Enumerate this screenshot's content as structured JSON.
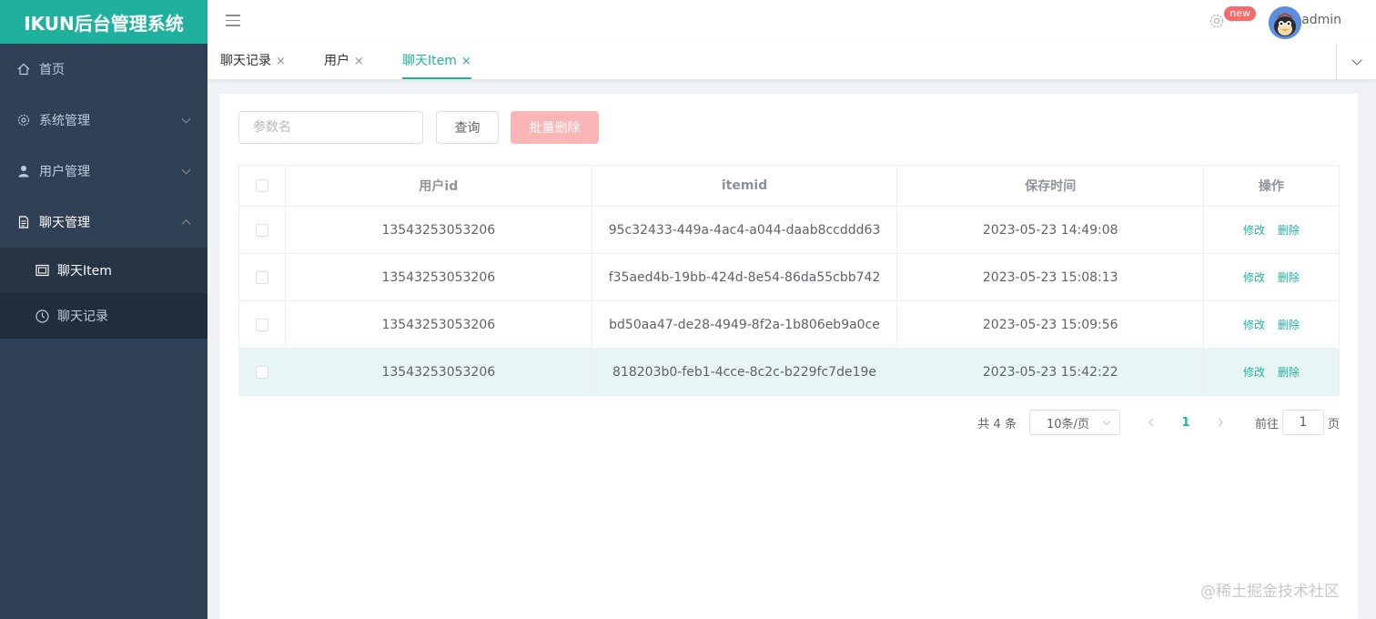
{
  "app": {
    "title": "IKUN后台管理系统"
  },
  "sidebar": {
    "items": [
      {
        "label": "首页",
        "icon": "home-icon"
      },
      {
        "label": "系统管理",
        "icon": "gear-icon"
      },
      {
        "label": "用户管理",
        "icon": "user-icon"
      },
      {
        "label": "聊天管理",
        "icon": "document-icon"
      }
    ],
    "subitems": [
      {
        "label": "聊天Item",
        "icon": "chat-item-icon"
      },
      {
        "label": "聊天记录",
        "icon": "clock-icon"
      }
    ]
  },
  "header": {
    "badge": "new",
    "username": "admin"
  },
  "tabs": [
    {
      "label": "聊天记录",
      "close": "×"
    },
    {
      "label": "用户",
      "close": "×"
    },
    {
      "label": "聊天Item",
      "close": "×"
    }
  ],
  "toolbar": {
    "search_placeholder": "参数名",
    "query_label": "查询",
    "batch_delete_label": "批量删除"
  },
  "table": {
    "columns": [
      "用户id",
      "itemid",
      "保存时间",
      "操作"
    ],
    "rows": [
      {
        "user_id": "13543253053206",
        "item_id": "95c32433-449a-4ac4-a044-daab8ccddd63",
        "time": "2023-05-23 14:49:08"
      },
      {
        "user_id": "13543253053206",
        "item_id": "f35aed4b-19bb-424d-8e54-86da55cbb742",
        "time": "2023-05-23 15:08:13"
      },
      {
        "user_id": "13543253053206",
        "item_id": "bd50aa47-de28-4949-8f2a-1b806eb9a0ce",
        "time": "2023-05-23 15:09:56"
      },
      {
        "user_id": "13543253053206",
        "item_id": "818203b0-feb1-4cce-8c2c-b229fc7de19e",
        "time": "2023-05-23 15:42:22"
      }
    ],
    "edit_label": "修改",
    "delete_label": "删除"
  },
  "pagination": {
    "total_text": "共 4 条",
    "page_size": "10条/页",
    "current_page": "1",
    "goto_label": "前往",
    "goto_value": "1",
    "page_unit": "页"
  },
  "watermark": "@稀土掘金技术社区",
  "colors": {
    "brand": "#1fb19e",
    "sidebar": "#304156",
    "danger_light": "#fab6b6"
  }
}
